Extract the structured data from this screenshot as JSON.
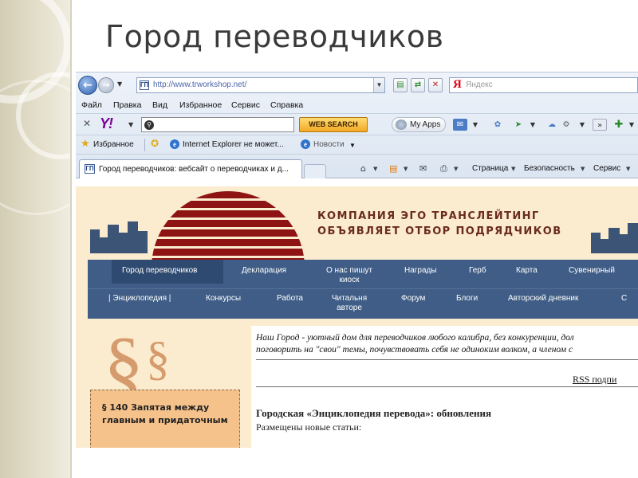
{
  "slide": {
    "title": "Город переводчиков"
  },
  "browser": {
    "url": "http://www.trworkshop.net/",
    "search_engine": "Яндекс",
    "menu": [
      "Файл",
      "Правка",
      "Вид",
      "Избранное",
      "Сервис",
      "Справка"
    ],
    "yahoo": {
      "logo": "Y!",
      "search_value": "",
      "web_search_label": "WEB SEARCH",
      "myapps_label": "My Apps"
    },
    "favorites": {
      "label": "Избранное",
      "link1": "Internet Explorer не может...",
      "link2": "Новости"
    },
    "tab": {
      "title": "Город переводчиков: вебсайт о переводчиках и д..."
    },
    "command_bar": {
      "page_label": "Страница",
      "security_label": "Безопасность",
      "tools_label": "Сервис"
    }
  },
  "site": {
    "banner_line1": "КОМПАНИЯ ЭГО ТРАНСЛЕЙТИНГ",
    "banner_line2": "ОБЪЯВЛЯЕТ ОТБОР ПОДРЯДЧИКОВ",
    "nav_row1": [
      "Город переводчиков",
      "Декларация",
      "О нас пишут\nкиоск",
      "Награды",
      "Герб",
      "Карта",
      "Сувенирный"
    ],
    "nav_row2": [
      "| Энциклопедия |",
      "Конкурсы",
      "Работа",
      "Читальня\nавторе",
      "Форум",
      "Блоги",
      "Авторский дневник",
      "С"
    ],
    "sidebox_text": "§ 140 Запятая между главным и придаточным",
    "intro_line1": "Наш Город - уютный дом для переводчиков любого калибра, без конкуренции, дол",
    "intro_line2": "поговорить на \"свои\" темы, почувствовать себя не одиноким волком, а членом с",
    "rss_label": "RSS подпи",
    "update_title": "Городская «Энциклопедия перевода»: обновления",
    "update_sub": "Размещены новые статьи:"
  },
  "colors": {
    "accent": "#3f5d86",
    "banner_red": "#8e1414",
    "page_bg": "#fbebcf"
  }
}
